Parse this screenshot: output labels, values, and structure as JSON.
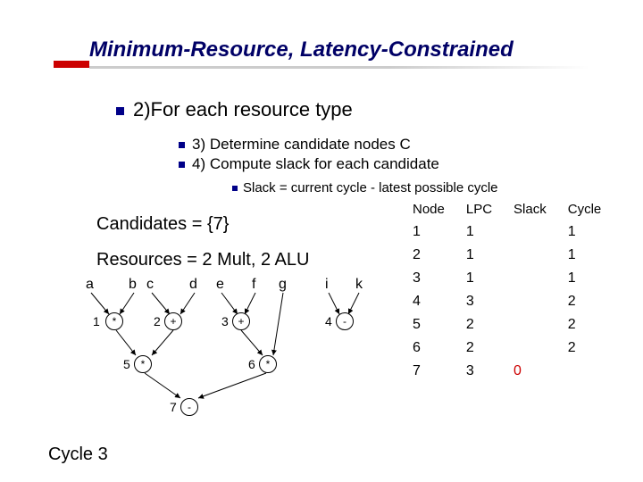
{
  "title": "Minimum-Resource, Latency-Constrained",
  "bullets": {
    "l1": "2)For each resource type",
    "l2a": "3) Determine candidate nodes C",
    "l2b": "4) Compute slack for each candidate",
    "l3": "Slack = current cycle - latest possible cycle"
  },
  "candidates": "Candidates = {7}",
  "resources": "Resources = 2 Mult, 2 ALU",
  "cycle": "Cycle 3",
  "vars": {
    "a": "a",
    "b": "b",
    "c": "c",
    "d": "d",
    "e": "e",
    "f": "f",
    "g": "g",
    "i": "i",
    "k": "k"
  },
  "nodes": {
    "n1": {
      "id": "1",
      "op": "*"
    },
    "n2": {
      "id": "2",
      "op": "+"
    },
    "n3": {
      "id": "3",
      "op": "+"
    },
    "n4": {
      "id": "4",
      "op": "-"
    },
    "n5": {
      "id": "5",
      "op": "*"
    },
    "n6": {
      "id": "6",
      "op": "*"
    },
    "n7": {
      "id": "7",
      "op": "-"
    }
  },
  "table": {
    "headers": [
      "Node",
      "LPC",
      "Slack",
      "Cycle"
    ],
    "rows": [
      {
        "node": "1",
        "lpc": "1",
        "slack": "",
        "cycle": "1"
      },
      {
        "node": "2",
        "lpc": "1",
        "slack": "",
        "cycle": "1"
      },
      {
        "node": "3",
        "lpc": "1",
        "slack": "",
        "cycle": "1"
      },
      {
        "node": "4",
        "lpc": "3",
        "slack": "",
        "cycle": "2"
      },
      {
        "node": "5",
        "lpc": "2",
        "slack": "",
        "cycle": "2"
      },
      {
        "node": "6",
        "lpc": "2",
        "slack": "",
        "cycle": "2"
      },
      {
        "node": "7",
        "lpc": "3",
        "slack": "0",
        "cycle": ""
      }
    ]
  }
}
